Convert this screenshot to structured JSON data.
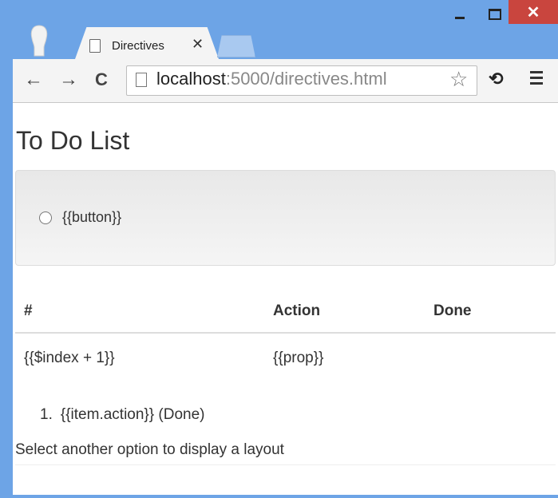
{
  "window": {
    "close_glyph": "✕"
  },
  "tab": {
    "title": "Directives",
    "close_glyph": "✕"
  },
  "toolbar": {
    "back_glyph": "←",
    "forward_glyph": "→",
    "reload_glyph": "C",
    "url_host": "localhost",
    "url_path": ":5000/directives.html",
    "star_glyph": "☆",
    "extension_glyph": "⟲"
  },
  "page": {
    "title": "To Do List",
    "radio_label": "{{button}}",
    "table": {
      "headers": [
        "#",
        "Action",
        "Done"
      ],
      "row": [
        "{{$index + 1}}",
        "{{prop}}",
        ""
      ]
    },
    "list_item": {
      "number": "1.",
      "text": "{{item.action}} (Done)"
    },
    "message": "Select another option to display a layout"
  },
  "colors": {
    "frame": "#6da4e6",
    "close_button": "#c9453e",
    "toolbar": "#f4f4f4"
  }
}
